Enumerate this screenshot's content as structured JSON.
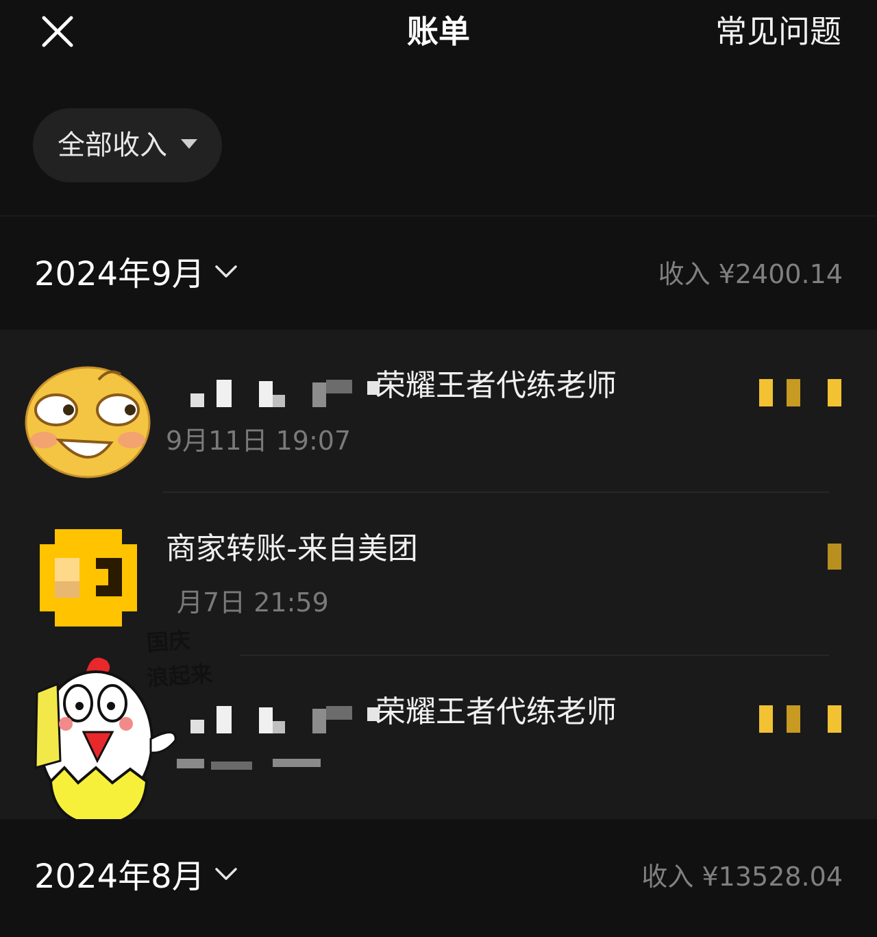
{
  "header": {
    "title": "账单",
    "faq_label": "常见问题",
    "close_icon": "close-icon"
  },
  "filter": {
    "label": "全部收入",
    "caret_icon": "caret-down-icon"
  },
  "months": [
    {
      "label": "2024年9月",
      "total": "收入 ¥2400.14",
      "transactions": [
        {
          "title": "荣耀王者代练老师",
          "time": "9月11日 19:07",
          "amount_icon": "amount-redacted"
        },
        {
          "title": "商家转账-来自美团",
          "time": "月7日 21:59",
          "amount_icon": "amount-redacted"
        },
        {
          "title": "荣耀王者代练老师",
          "time": "",
          "amount_icon": "amount-redacted"
        }
      ]
    },
    {
      "label": "2024年8月",
      "total": "收入 ¥13528.04"
    }
  ],
  "sticker": {
    "text_line1": "国庆",
    "text_line2": "浪起来"
  },
  "colors": {
    "background": "#111111",
    "list_background": "#1a1a1a",
    "muted_text": "#808080",
    "amount_yellow": "#f2c233"
  }
}
